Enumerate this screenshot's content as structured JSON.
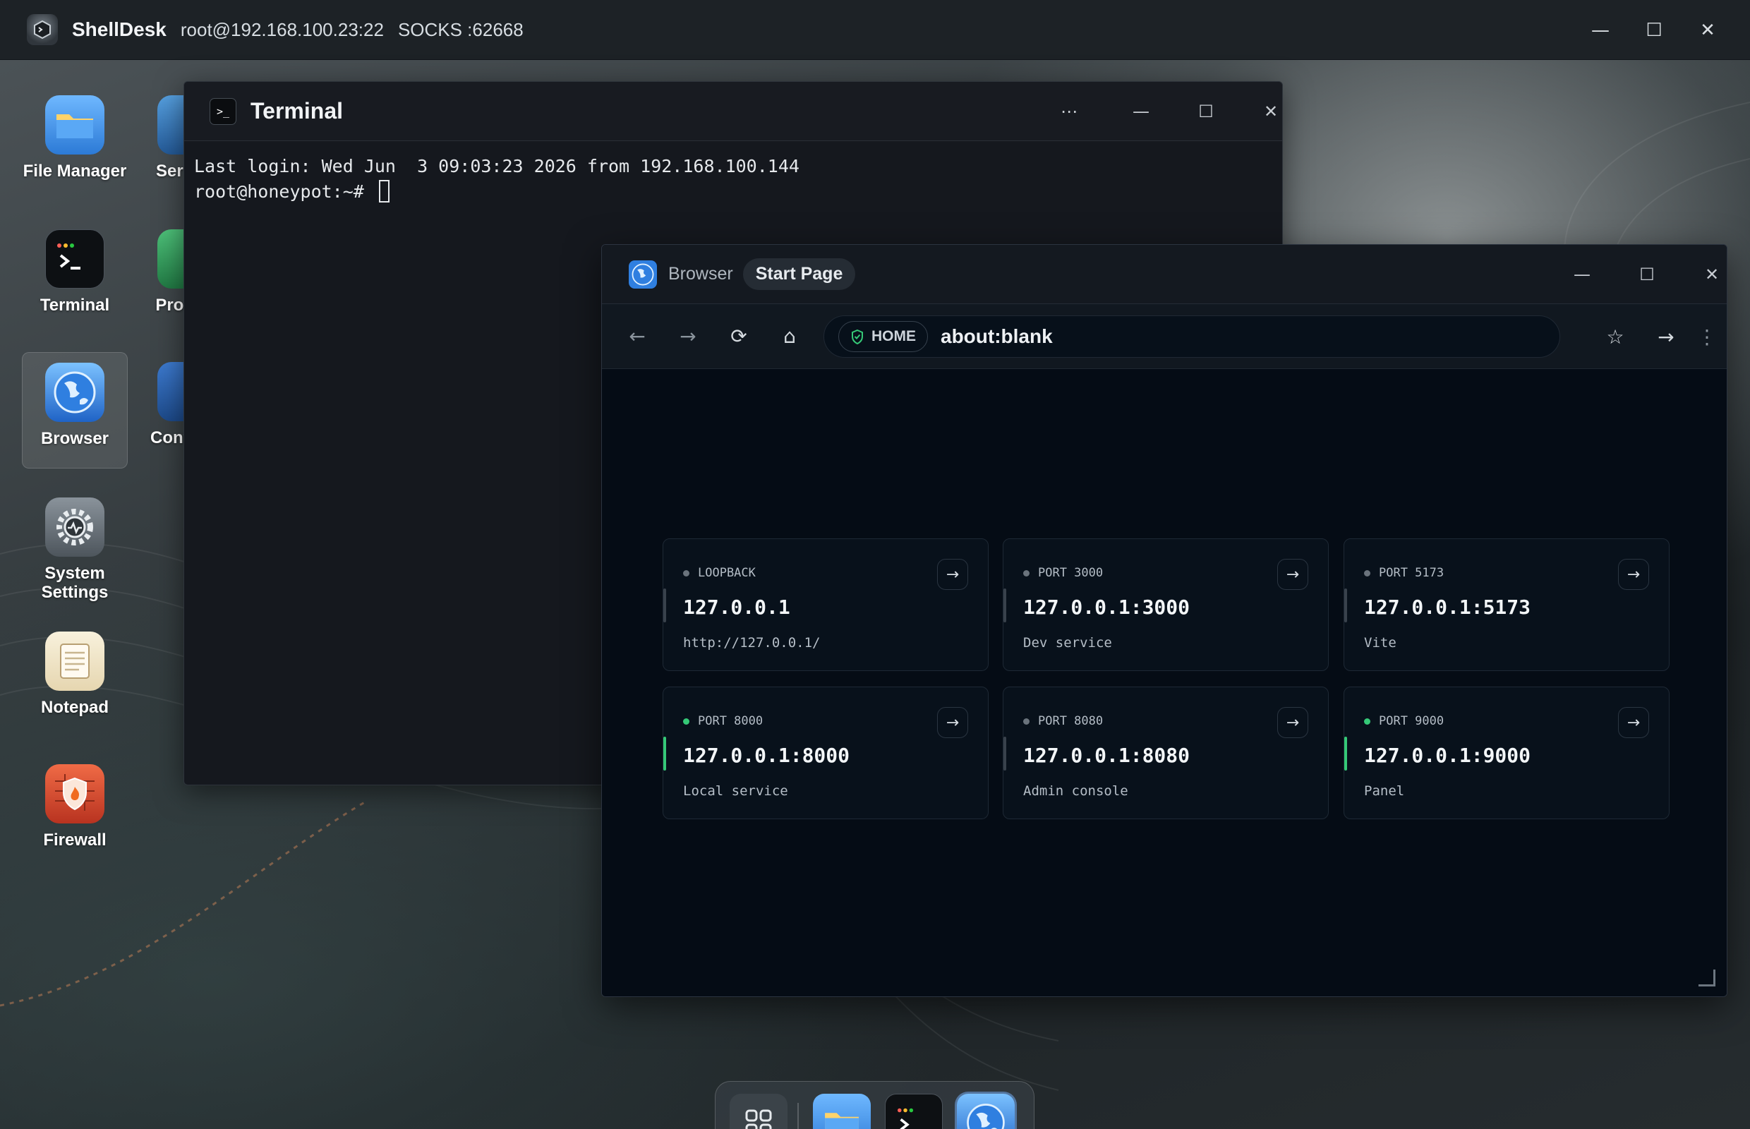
{
  "app": {
    "name": "ShellDesk",
    "host": "root@192.168.100.23:22",
    "socks": "SOCKS :62668"
  },
  "desktop_icons": [
    {
      "label": "File Manager"
    },
    {
      "label": "Terminal"
    },
    {
      "label": "Browser"
    },
    {
      "label": "System Settings"
    },
    {
      "label": "Notepad"
    },
    {
      "label": "Firewall"
    },
    {
      "label": "Ser Mar"
    },
    {
      "label": "Pro Mar"
    },
    {
      "label": "Cont Mar"
    }
  ],
  "terminal": {
    "title": "Terminal",
    "lines": [
      "Last login: Wed Jun  3 09:03:23 2026 from 192.168.100.144",
      "root@honeypot:~# "
    ]
  },
  "browser": {
    "app_label": "Browser",
    "tab_title": "Start Page",
    "home_chip": "HOME",
    "url": "about:blank",
    "cards": [
      {
        "tag": "LOOPBACK",
        "address": "127.0.0.1",
        "description": "http://127.0.0.1/",
        "live": false
      },
      {
        "tag": "PORT 3000",
        "address": "127.0.0.1:3000",
        "description": "Dev service",
        "live": false
      },
      {
        "tag": "PORT 5173",
        "address": "127.0.0.1:5173",
        "description": "Vite",
        "live": false
      },
      {
        "tag": "PORT 8000",
        "address": "127.0.0.1:8000",
        "description": "Local service",
        "live": true
      },
      {
        "tag": "PORT 8080",
        "address": "127.0.0.1:8080",
        "description": "Admin console",
        "live": false
      },
      {
        "tag": "PORT 9000",
        "address": "127.0.0.1:9000",
        "description": "Panel",
        "live": true
      }
    ]
  },
  "colors": {
    "accent_live": "#35c977",
    "folder_blue": "#3f8fe6",
    "firewall_red": "#d84b2e"
  }
}
